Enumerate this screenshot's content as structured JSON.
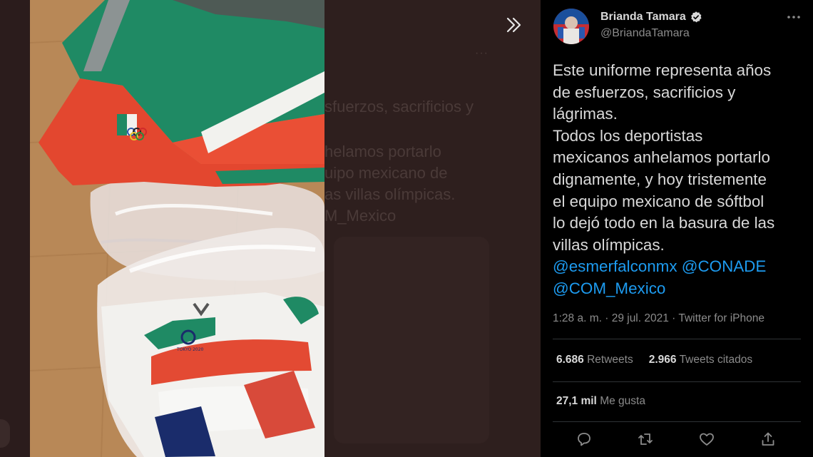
{
  "backdrop": {
    "ghost_lines": [
      "sfuerzos, sacrificios y",
      "helamos portarlo",
      "uipo mexicano de",
      "as villas olímpicas.",
      "M_Mexico"
    ],
    "more_glyph": "···"
  },
  "viewer": {
    "expand_glyph": "»"
  },
  "tweet": {
    "author_name": "Brianda Tamara",
    "author_handle": "@BriandaTamara",
    "more_glyph": "···",
    "lines": [
      "Este uniforme representa años",
      "de esfuerzos, sacrificios y",
      "lágrimas.",
      "Todos los deportistas",
      "mexicanos anhelamos portarlo",
      "dignamente, y hoy tristemente",
      "el equipo mexicano de sóftbol",
      "lo dejó todo en la basura de las",
      "villas olímpicas."
    ],
    "mention_line1": "@esmerfalconmx @CONADE",
    "mention_line2": "@COM_Mexico",
    "timestamp": "1:28 a. m. · 29 jul. 2021 · Twitter for iPhone",
    "retweets_count": "6.686",
    "retweets_label": "Retweets",
    "quotes_count": "2.966",
    "quotes_label": "Tweets citados",
    "likes_count": "27,1 mil",
    "likes_label": "Me gusta"
  },
  "colors": {
    "panel_bg": "#000000",
    "link": "#1d9bf0",
    "muted": "#8b8b8b",
    "verified": "#d9d9d9"
  },
  "icons": [
    "expand-icon",
    "verified-badge-icon",
    "more-icon",
    "reply-icon",
    "retweet-icon",
    "like-icon",
    "share-icon"
  ]
}
